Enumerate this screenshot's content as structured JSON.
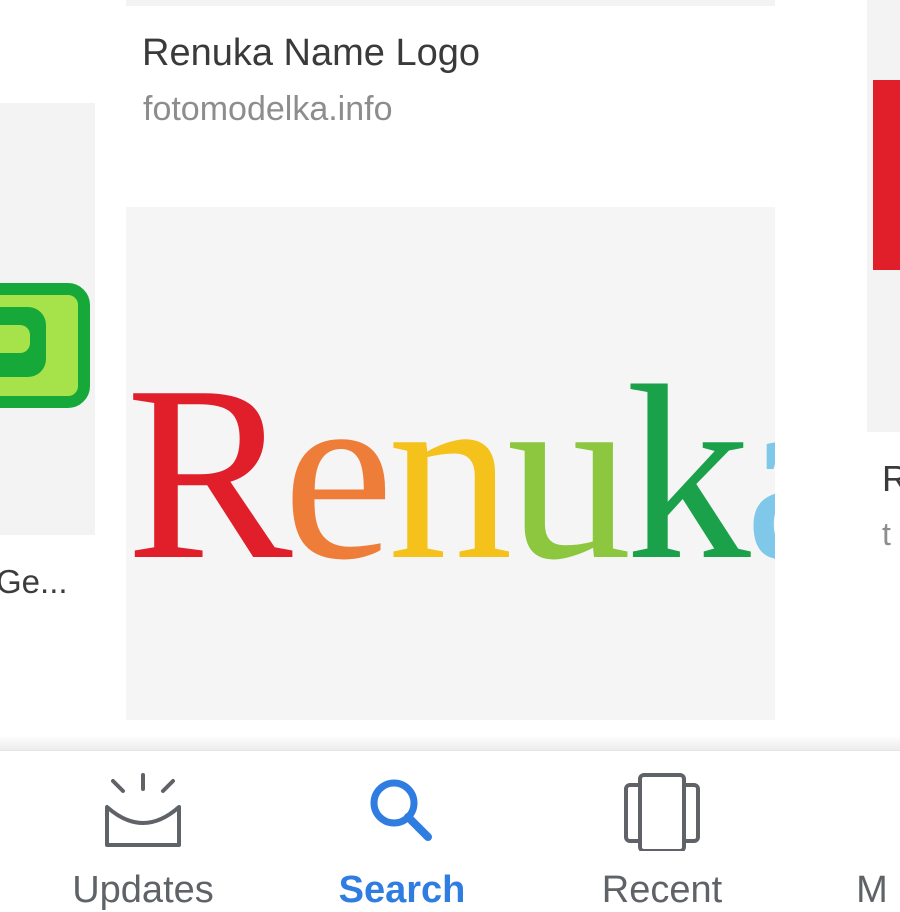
{
  "results": {
    "left": {
      "caption": "Ge..."
    },
    "center": {
      "title": "Renuka Name Logo",
      "source": "fotomodelka.info",
      "image_text": "Renuka"
    },
    "right": {
      "title": "R",
      "source": "t"
    }
  },
  "logo_colors": [
    "#e01f2b",
    "#ef7d3a",
    "#f4c21a",
    "#8dc63f",
    "#1ba14a",
    "#7fc8ea"
  ],
  "bottom_nav": {
    "items": [
      {
        "label": "Updates",
        "icon": "updates-icon"
      },
      {
        "label": "Search",
        "icon": "search-icon",
        "active": true
      },
      {
        "label": "Recent",
        "icon": "recent-icon"
      },
      {
        "label": "M",
        "icon": "menu-icon"
      }
    ],
    "active_color": "#2f7de1",
    "inactive_color": "#5f6368"
  }
}
